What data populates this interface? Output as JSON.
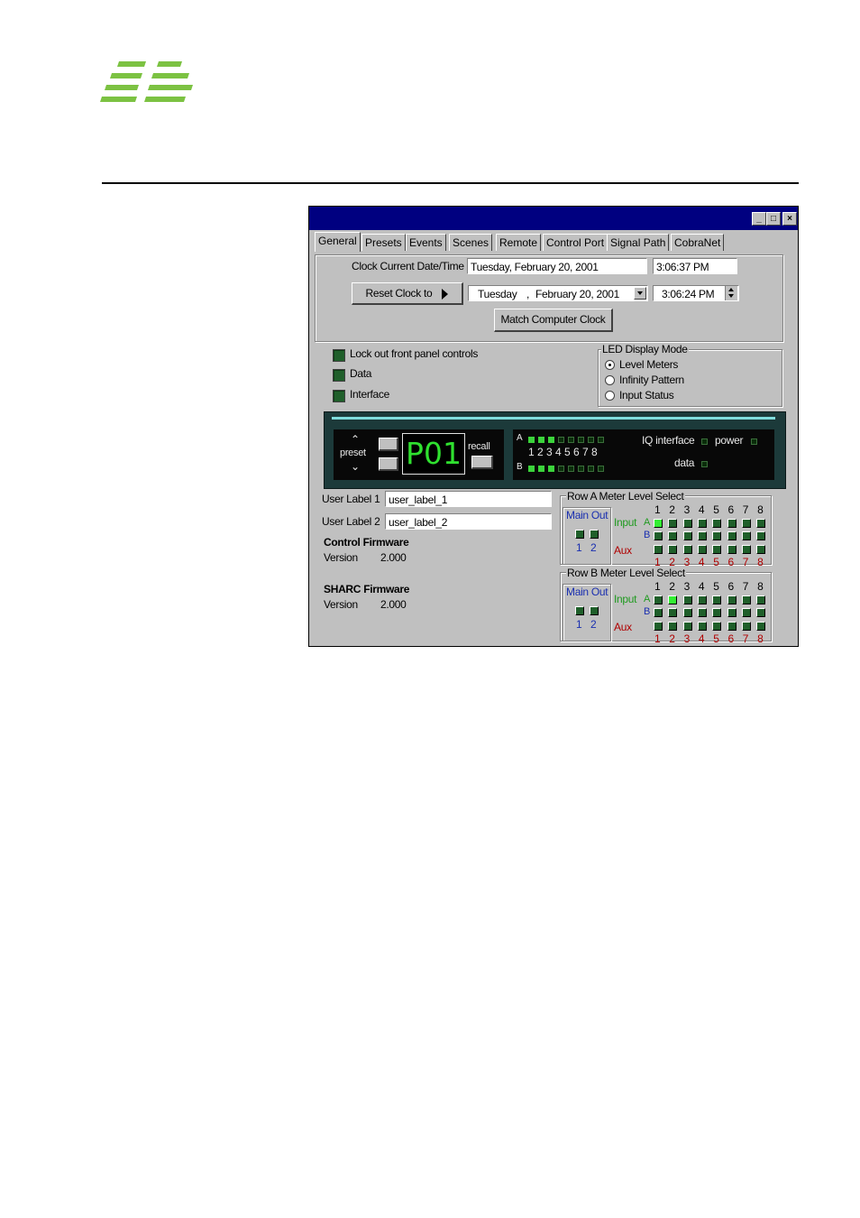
{
  "window": {
    "controls": {
      "minimize": "_",
      "maximize": "□",
      "close": "×"
    },
    "tabs": [
      "General",
      "Presets",
      "Events",
      "Scenes",
      "Remote",
      "Control Port",
      "Signal Path",
      "CobraNet"
    ],
    "active_tab": "General"
  },
  "clock": {
    "current_label": "Clock Current Date/Time",
    "current_date": "Tuesday, February 20, 2001",
    "current_time": "3:06:37 PM",
    "reset_label": "Reset Clock to",
    "reset_day": "Tuesday",
    "reset_sep": ",",
    "reset_month_day": "February  20, 2001",
    "reset_time": "3:06:24 PM",
    "match_label": "Match Computer Clock"
  },
  "options": {
    "lockout": "Lock out front panel controls",
    "data": "Data",
    "interface": "Interface"
  },
  "led_mode": {
    "title": "LED Display Mode",
    "options": [
      "Level Meters",
      "Infinity Pattern",
      "Input Status"
    ],
    "selected": "Level Meters"
  },
  "front_panel": {
    "preset_label": "preset",
    "display": "P01",
    "recall_label": "recall",
    "row_a": "A",
    "row_b": "B",
    "numbers": "1 2 3 4 5 6 7 8",
    "iq_interface": "IQ interface",
    "power": "power",
    "data": "data"
  },
  "labels": {
    "user1_label": "User Label 1",
    "user1_value": "user_label_1",
    "user2_label": "User Label 2",
    "user2_value": "user_label_2"
  },
  "firmware": {
    "control_title": "Control Firmware",
    "control_version_label": "Version",
    "control_version": "2.000",
    "sharc_title": "SHARC Firmware",
    "sharc_version_label": "Version",
    "sharc_version": "2.000"
  },
  "meter_select": {
    "row_a_title": "Row A Meter Level Select",
    "row_b_title": "Row B Meter Level Select",
    "main_out": "Main Out",
    "main_nums": [
      "1",
      "2"
    ],
    "input": "Input",
    "aux": "Aux",
    "a": "A",
    "b": "B",
    "channels": [
      "1",
      "2",
      "3",
      "4",
      "5",
      "6",
      "7",
      "8"
    ]
  }
}
